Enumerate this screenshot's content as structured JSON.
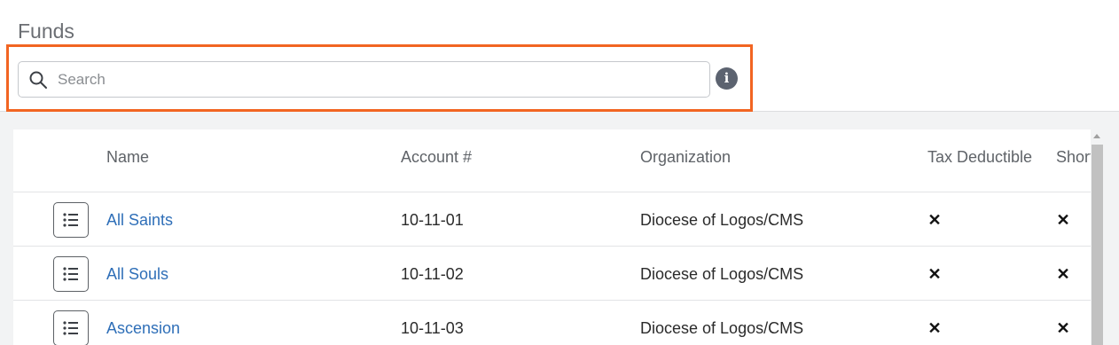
{
  "page": {
    "title": "Funds"
  },
  "search": {
    "placeholder": "Search",
    "value": ""
  },
  "table": {
    "columns": [
      "Name",
      "Account #",
      "Organization",
      "Tax Deductible",
      "Shortfall Py"
    ],
    "rows": [
      {
        "name": "All Saints",
        "account": "10-11-01",
        "organization": "Diocese of Logos/CMS",
        "tax_deductible": "✕",
        "shortfall": "✕"
      },
      {
        "name": "All Souls",
        "account": "10-11-02",
        "organization": "Diocese of Logos/CMS",
        "tax_deductible": "✕",
        "shortfall": "✕"
      },
      {
        "name": "Ascension",
        "account": "10-11-03",
        "organization": "Diocese of Logos/CMS",
        "tax_deductible": "✕",
        "shortfall": "✕"
      }
    ]
  },
  "colors": {
    "highlight": "#f26522",
    "link": "#2f6fb8",
    "info_icon": "#5c6370"
  },
  "icons": {
    "search": "search-icon",
    "info": "info-icon",
    "row_menu": "list-icon",
    "false_value": "x-icon"
  }
}
